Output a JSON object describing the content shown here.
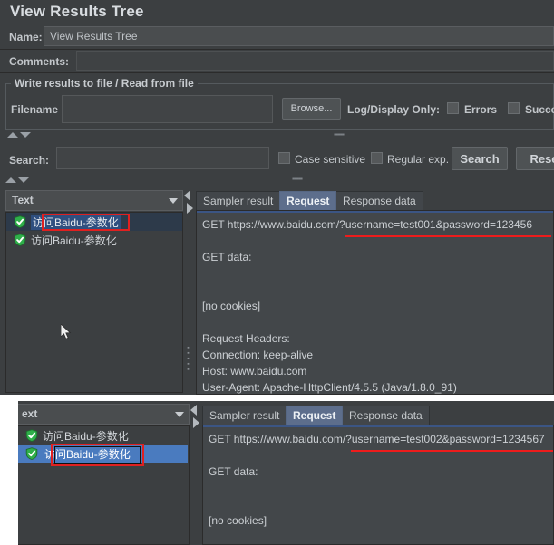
{
  "window": {
    "title": "View Results Tree"
  },
  "form": {
    "name_label": "Name:",
    "name_value": "View Results Tree",
    "comments_label": "Comments:",
    "comments_value": ""
  },
  "file_group": {
    "legend": "Write results to file / Read from file",
    "filename_label": "Filename",
    "filename_value": "",
    "browse_label": "Browse...",
    "log_display_label": "Log/Display Only:",
    "errors_label": "Errors",
    "successes_label": "Succe",
    "errors_checked": false,
    "successes_checked": false
  },
  "search_bar": {
    "search_label": "Search:",
    "search_value": "",
    "case_sensitive_label": "Case sensitive",
    "case_sensitive_checked": false,
    "regular_exp_label": "Regular exp.",
    "regular_exp_checked": false,
    "search_button": "Search",
    "reset_button": "Rese"
  },
  "top_panel": {
    "renderer_selected": "Text",
    "tree_items": [
      {
        "label": "访问Baidu-参数化",
        "status": "success",
        "selected": true,
        "highlighted": true
      },
      {
        "label": "访问Baidu-参数化",
        "status": "success",
        "selected": false,
        "highlighted": false
      }
    ],
    "tabs": [
      {
        "label": "Sampler result",
        "active": false
      },
      {
        "label": "Request",
        "active": true
      },
      {
        "label": "Response data",
        "active": false
      }
    ],
    "request_lines": [
      "GET https://www.baidu.com/?username=test001&password=123456",
      "",
      "GET data:",
      "",
      "",
      "[no cookies]",
      "",
      "Request Headers:",
      "Connection: keep-alive",
      "Host: www.baidu.com",
      "User-Agent: Apache-HttpClient/4.5.5 (Java/1.8.0_91)"
    ]
  },
  "bottom_panel": {
    "renderer_selected": "ext",
    "tree_items": [
      {
        "label": "访问Baidu-参数化",
        "status": "success",
        "selected": false,
        "highlighted": false
      },
      {
        "label": "访问Baidu-参数化",
        "status": "success",
        "selected": true,
        "highlighted": true
      }
    ],
    "tabs": [
      {
        "label": "Sampler result",
        "active": false
      },
      {
        "label": "Request",
        "active": true
      },
      {
        "label": "Response data",
        "active": false
      }
    ],
    "request_lines": [
      "GET https://www.baidu.com/?username=test002&password=1234567",
      "",
      "GET data:",
      "",
      "",
      "[no cookies]"
    ]
  },
  "colors": {
    "background": "#3c3f41",
    "panel": "#43474a",
    "accent_tab": "#5d6e8c",
    "annotation_red": "#ee1c1c",
    "selection_blue": "#4a7bbf",
    "success_green": "#2faf4a"
  }
}
